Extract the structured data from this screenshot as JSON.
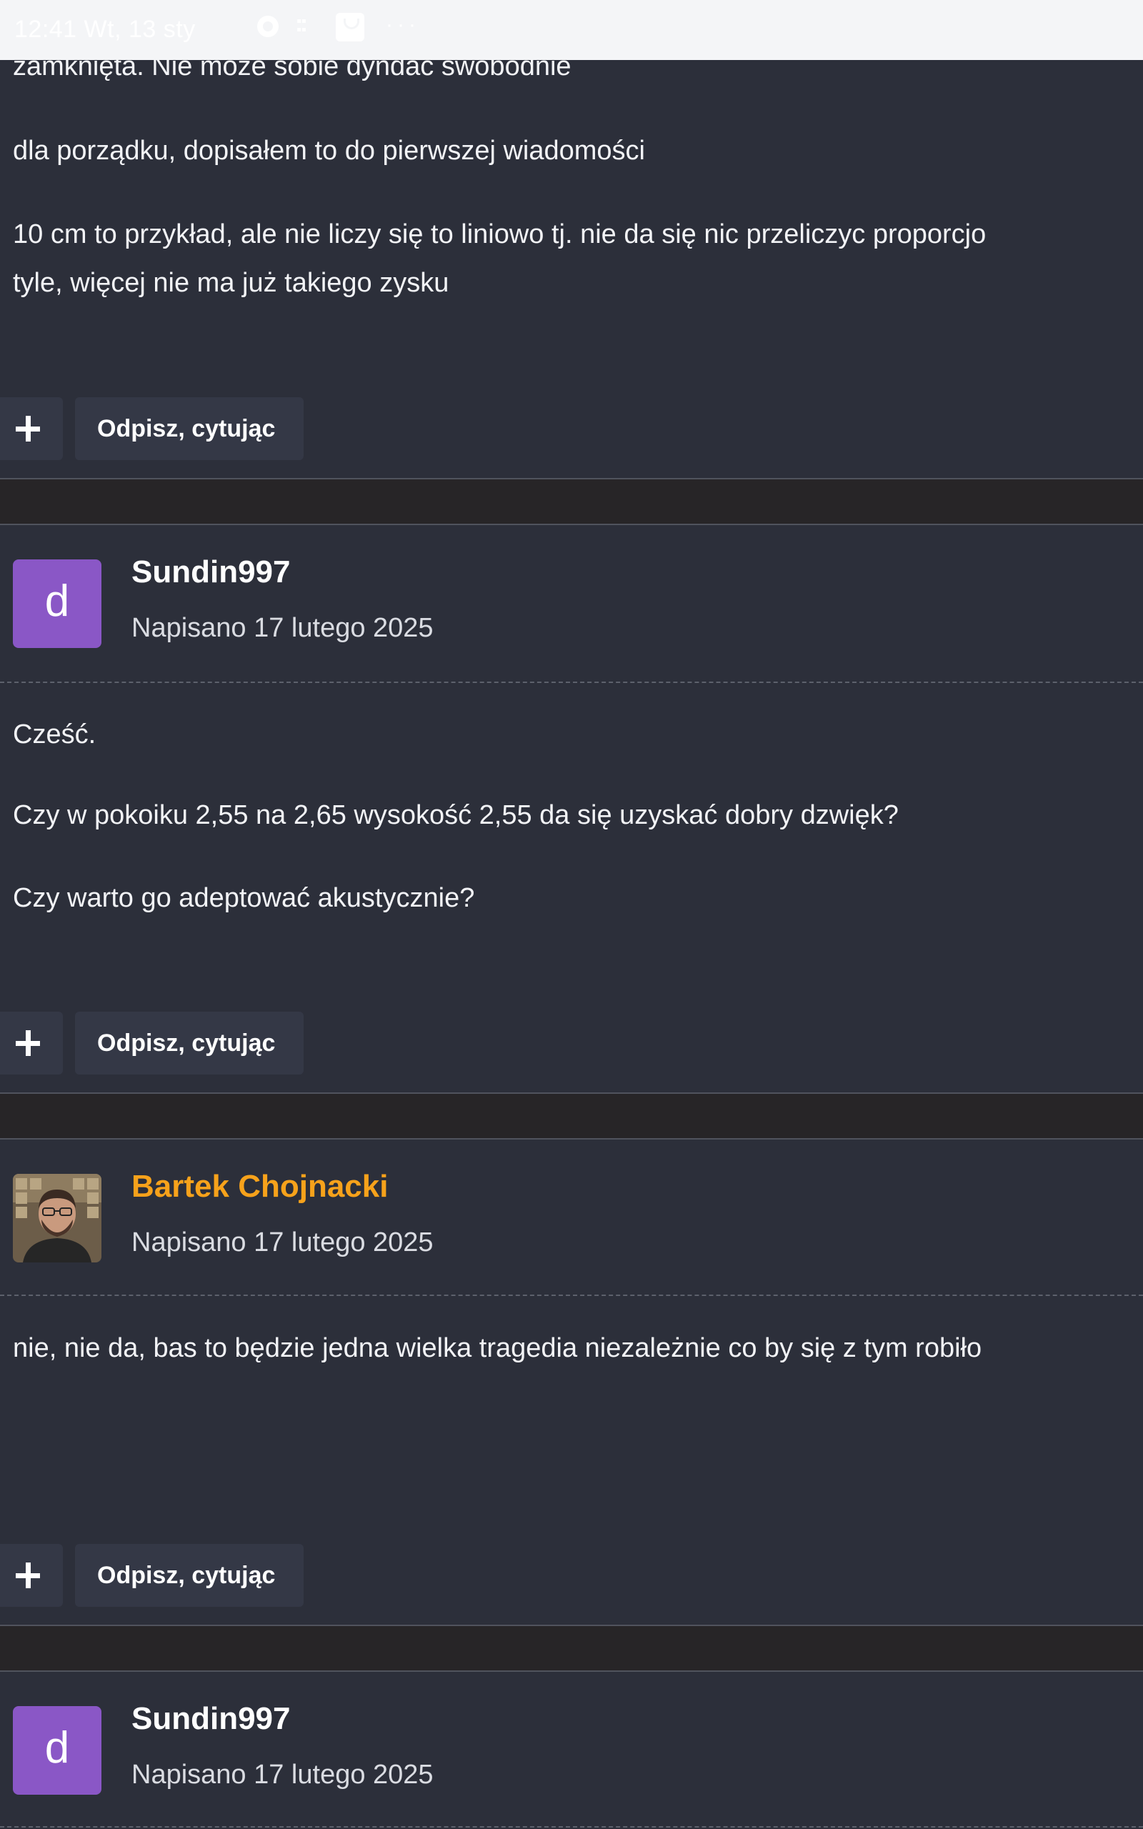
{
  "status_bar": {
    "time": "12:41",
    "date": "Wt, 13 sty",
    "icons": [
      "ring-app-icon",
      "app-grid-icon",
      "shopping-bag-icon"
    ],
    "more": "···"
  },
  "posts": [
    {
      "author": "",
      "date": "",
      "body": [
        "zamknięta. Nie może sobie dyndać swobodnie",
        "dla porządku, dopisałem to do pierwszej wiadomości",
        "10 cm to przykład, ale nie liczy się to liniowo tj. nie da się nic przeliczyc proporcjo",
        "tyle, więcej nie ma już takiego zysku"
      ]
    },
    {
      "author": "Sundin997",
      "author_color": "#ffffff",
      "avatar_letter": "d",
      "avatar_color": "#8a57c6",
      "date": "Napisano 17 lutego 2025",
      "body": [
        "Cześć.",
        "Czy w pokoiku 2,55 na 2,65 wysokość 2,55 da się uzyskać dobry dzwięk?",
        "Czy warto go adeptować akustycznie?"
      ]
    },
    {
      "author": "Bartek Chojnacki",
      "author_color": "#f7a21b",
      "date": "Napisano 17 lutego 2025",
      "body": [
        "nie, nie da, bas to będzie jedna wielka tragedia niezależnie co by się z tym robiło"
      ]
    },
    {
      "author": "Sundin997",
      "author_color": "#ffffff",
      "avatar_letter": "d",
      "avatar_color": "#8a57c6",
      "date": "Napisano 17 lutego 2025",
      "body": []
    }
  ],
  "actions": {
    "quote_label": "Odpisz, cytując"
  },
  "colors": {
    "background": "#2c2f3a",
    "button": "#343846",
    "gap": "#272527",
    "accent_author": "#f7a21b"
  }
}
